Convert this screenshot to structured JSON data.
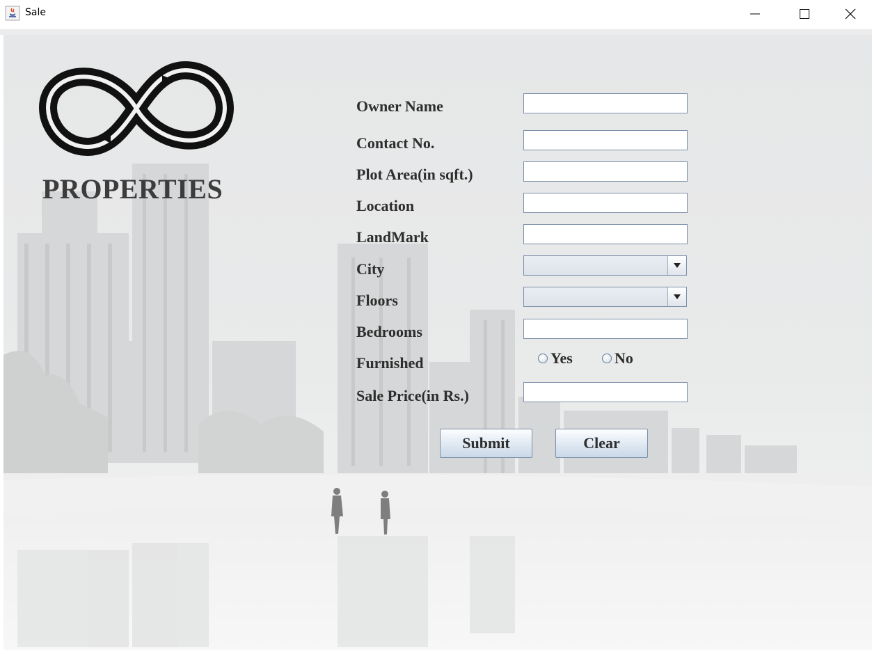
{
  "window": {
    "title": "Sale",
    "app_icon": "java-cup-icon",
    "controls": [
      "minimize-icon",
      "maximize-icon",
      "close-icon"
    ]
  },
  "brand": {
    "logo_icon": "infinity-logo-icon",
    "name": "PROPERTIES"
  },
  "form": {
    "owner_name": {
      "label": "Owner Name",
      "value": ""
    },
    "contact_no": {
      "label": "Contact No.",
      "value": ""
    },
    "plot_area": {
      "label": "Plot Area(in sqft.)",
      "value": ""
    },
    "location": {
      "label": "Location",
      "value": ""
    },
    "landmark": {
      "label": "LandMark",
      "value": ""
    },
    "city": {
      "label": "City",
      "selected": ""
    },
    "floors": {
      "label": "Floors",
      "selected": ""
    },
    "bedrooms": {
      "label": "Bedrooms",
      "value": ""
    },
    "furnished": {
      "label": "Furnished",
      "options": [
        {
          "label": "Yes",
          "checked": false
        },
        {
          "label": "No",
          "checked": false
        }
      ]
    },
    "sale_price": {
      "label": "Sale Price(in Rs.)",
      "value": ""
    }
  },
  "buttons": {
    "submit": "Submit",
    "clear": "Clear"
  },
  "colors": {
    "label_text": "#2d2d2d",
    "field_border": "#7a8ea8",
    "background": "#e8e9ea"
  }
}
